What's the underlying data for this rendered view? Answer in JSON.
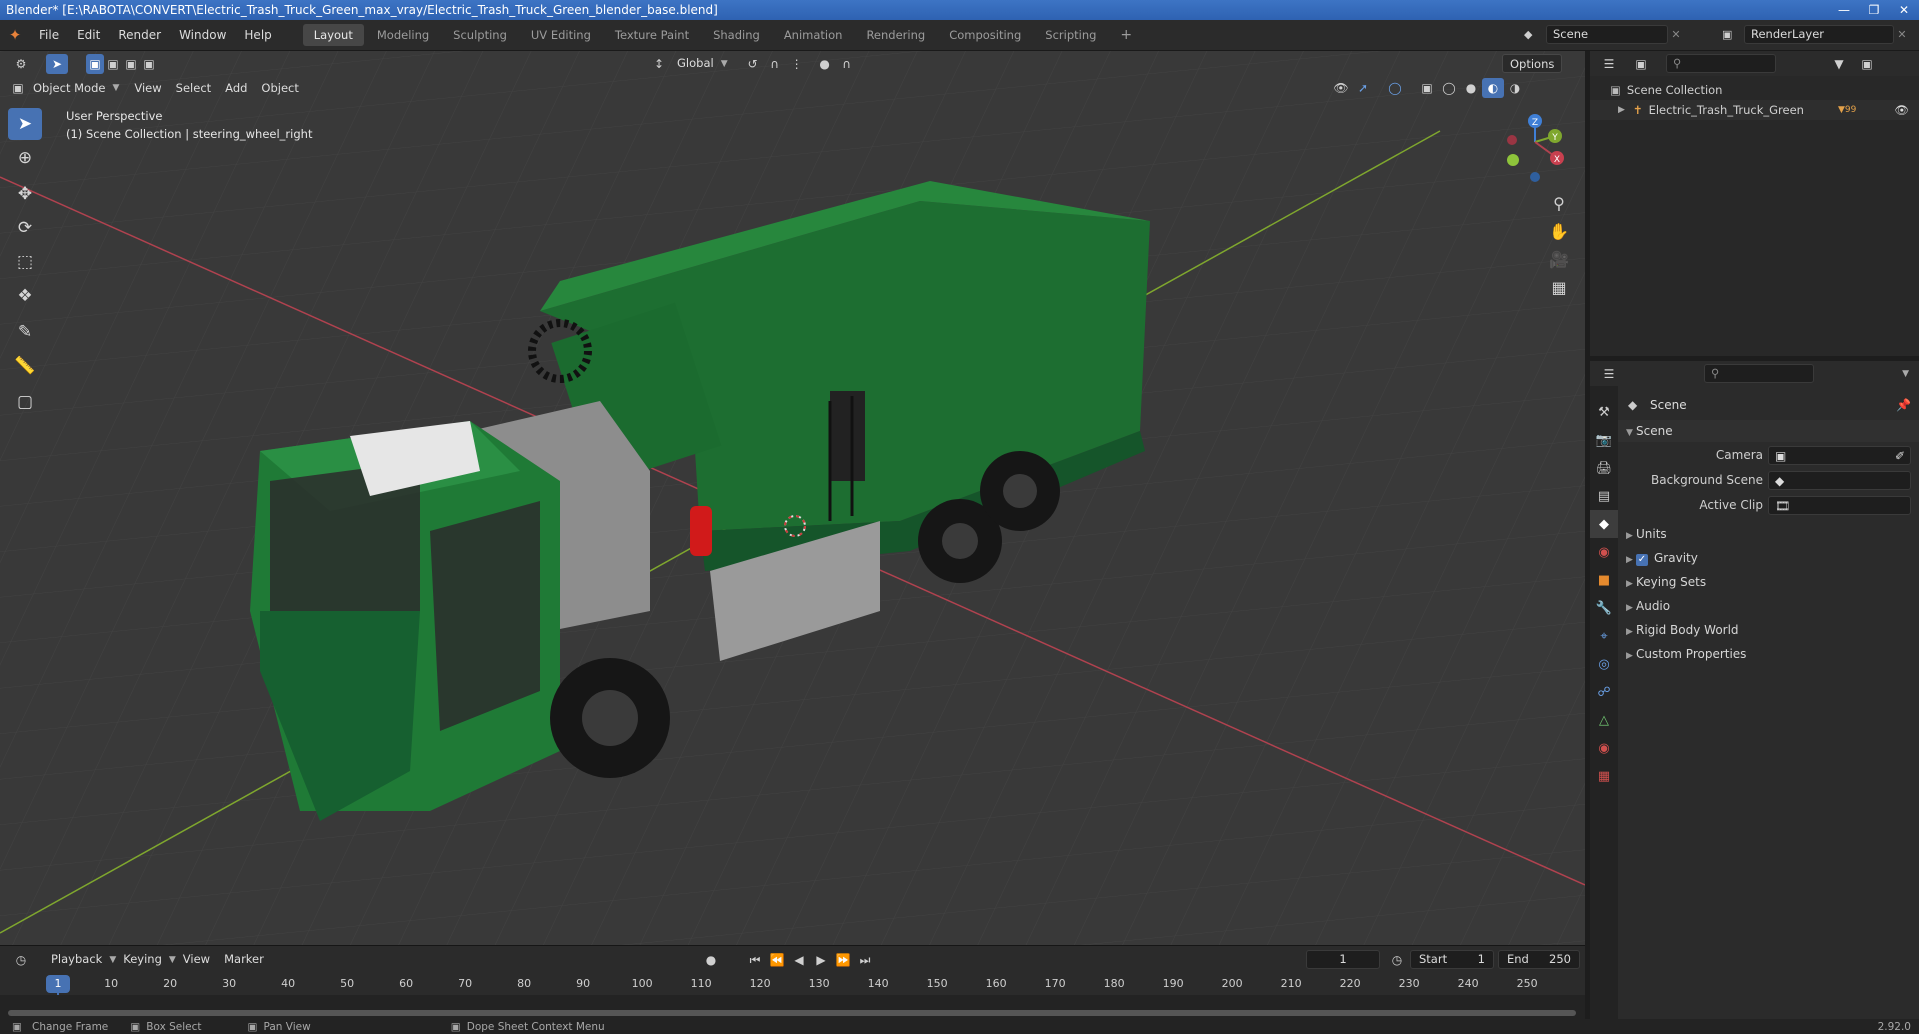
{
  "window": {
    "title": "Blender* [E:\\RABOTA\\CONVERT\\Electric_Trash_Truck_Green_max_vray/Electric_Trash_Truck_Green_blender_base.blend]"
  },
  "menubar": {
    "items": [
      "File",
      "Edit",
      "Render",
      "Window",
      "Help"
    ],
    "workspaces": [
      "Layout",
      "Modeling",
      "Sculpting",
      "UV Editing",
      "Texture Paint",
      "Shading",
      "Animation",
      "Rendering",
      "Compositing",
      "Scripting"
    ],
    "active_workspace": "Layout",
    "scene_name": "Scene",
    "render_layer": "RenderLayer"
  },
  "viewport": {
    "transform_orientation": "Global",
    "options_label": "Options",
    "mode": "Object Mode",
    "menus": [
      "View",
      "Select",
      "Add",
      "Object"
    ],
    "perspective_label": "User Perspective",
    "collection_info": "(1) Scene Collection | steering_wheel_right",
    "gizmo_axes": [
      "Z",
      "Y",
      "X"
    ],
    "colors": {
      "x_axis": "#b0424f",
      "y_axis": "#7fa72e",
      "z_axis": "#3f7fd6",
      "truck_green": "#1f7a36",
      "grid_bg": "#3a3a3a"
    }
  },
  "timeline": {
    "playback": "Playback",
    "keying": "Keying",
    "view": "View",
    "marker": "Marker",
    "current_frame": "1",
    "start_label": "Start",
    "start_value": "1",
    "end_label": "End",
    "end_value": "250",
    "ruler_current": "1",
    "ruler_ticks": [
      "10",
      "20",
      "30",
      "40",
      "50",
      "60",
      "70",
      "80",
      "90",
      "100",
      "110",
      "120",
      "130",
      "140",
      "150",
      "160",
      "170",
      "180",
      "190",
      "200",
      "210",
      "220",
      "230",
      "240",
      "250"
    ]
  },
  "statusbar": {
    "items": [
      "Change Frame",
      "Box Select",
      "Pan View",
      "Dope Sheet Context Menu"
    ],
    "version": "2.92.0"
  },
  "outliner": {
    "root": "Scene Collection",
    "items": [
      {
        "label": "Electric_Trash_Truck_Green",
        "badge": "99"
      }
    ]
  },
  "properties": {
    "context": "Scene",
    "panel_title": "Scene",
    "fields": [
      {
        "label": "Camera"
      },
      {
        "label": "Background Scene"
      },
      {
        "label": "Active Clip"
      }
    ],
    "subpanels": [
      "Units",
      "Gravity",
      "Keying Sets",
      "Audio",
      "Rigid Body World",
      "Custom Properties"
    ]
  }
}
